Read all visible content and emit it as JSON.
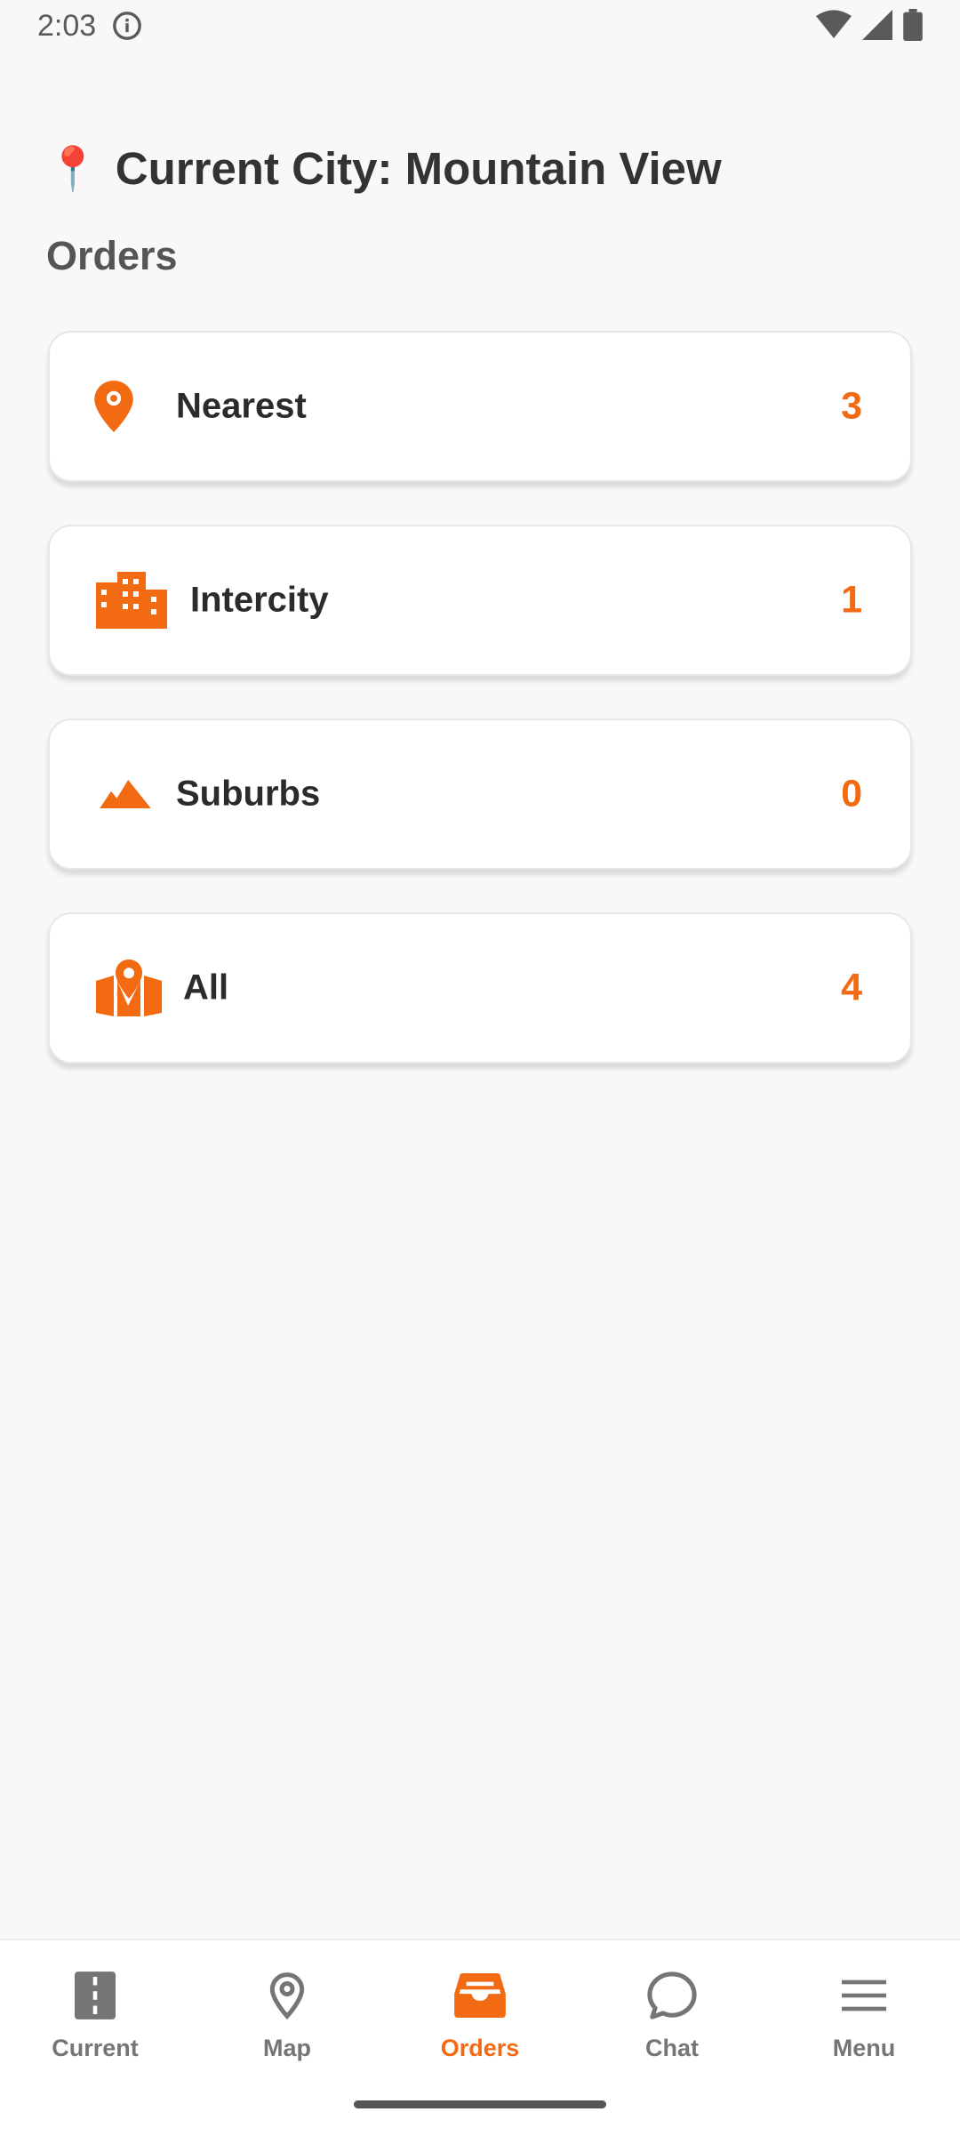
{
  "status": {
    "time": "2:03"
  },
  "header": {
    "city_pin_emoji": "📍",
    "city_label": "Current City: Mountain View"
  },
  "orders": {
    "title": "Orders",
    "items": [
      {
        "label": "Nearest",
        "count": "3",
        "icon": "location-pin-icon"
      },
      {
        "label": "Intercity",
        "count": "1",
        "icon": "city-buildings-icon"
      },
      {
        "label": "Suburbs",
        "count": "0",
        "icon": "mountains-icon"
      },
      {
        "label": "All",
        "count": "4",
        "icon": "map-pin-icon"
      }
    ]
  },
  "nav": {
    "items": [
      {
        "label": "Current",
        "icon": "road-icon",
        "active": false
      },
      {
        "label": "Map",
        "icon": "map-pin-outline-icon",
        "active": false
      },
      {
        "label": "Orders",
        "icon": "inbox-tray-icon",
        "active": true
      },
      {
        "label": "Chat",
        "icon": "chat-bubble-icon",
        "active": false
      },
      {
        "label": "Menu",
        "icon": "hamburger-menu-icon",
        "active": false
      }
    ]
  },
  "colors": {
    "accent": "#f26a12",
    "text": "#2b2b2b",
    "muted": "#757575",
    "background": "#f8f8f8"
  }
}
